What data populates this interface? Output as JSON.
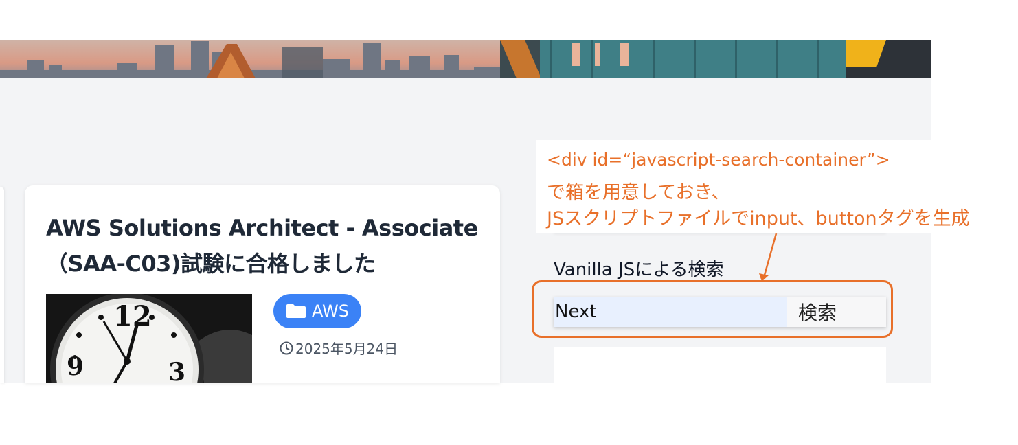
{
  "colors": {
    "accent_annotation": "#e8702a",
    "category_chip": "#3b82f6",
    "input_autofill": "#e8f0fe",
    "page_background": "#f3f4f6"
  },
  "post": {
    "title": "AWS Solutions Architect - Associate（SAA-C03)試験に合格しました",
    "category": "AWS",
    "category_icon": "folder-icon",
    "date": "2025年5月24日",
    "date_icon": "clock-icon"
  },
  "sidebar": {
    "widget_title": "Vanilla JSによる検索",
    "search": {
      "input_value": "Next",
      "button_label": "検索"
    }
  },
  "annotation": {
    "line1": "<div id=“javascript-search-container”>",
    "line2": "で箱を用意しておき、",
    "line3": "JSスクリプトファイルでinput、buttonタグを生成"
  }
}
